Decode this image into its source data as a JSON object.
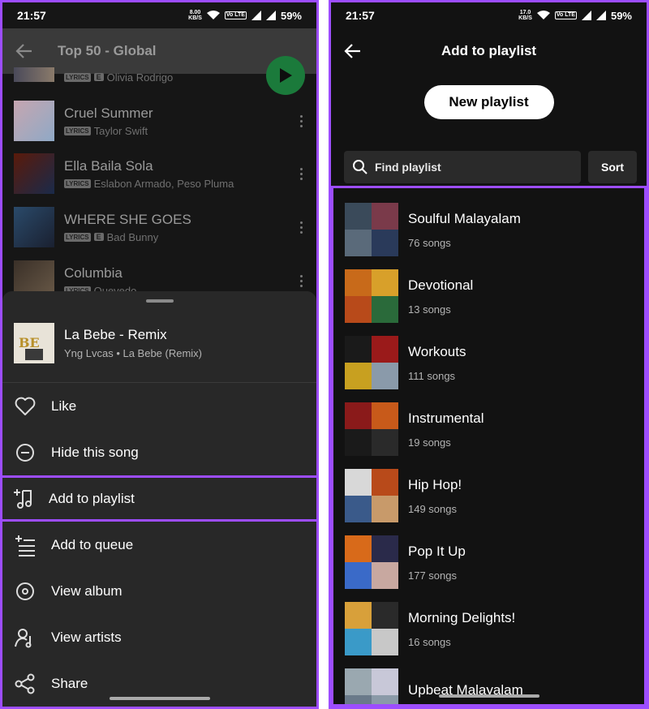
{
  "statusbar": {
    "time": "21:57",
    "left_speed": "8.00",
    "right_speed": "17.0",
    "speed_unit": "KB/S",
    "lte": "Vo LTE",
    "battery": "59%"
  },
  "left": {
    "header_title": "Top 50 - Global",
    "tracks": [
      {
        "name": "",
        "artist": "Olivia Rodrigo",
        "lyrics_badge": "LYRICS",
        "explicit": "E",
        "colors": [
          "#4a4a5a",
          "#8a7a6a"
        ]
      },
      {
        "name": "Cruel Summer",
        "artist": "Taylor Swift",
        "lyrics_badge": "LYRICS",
        "explicit": "",
        "colors": [
          "#c6a6b0",
          "#8fa9c6"
        ]
      },
      {
        "name": "Ella Baila Sola",
        "artist": "Eslabon Armado, Peso Pluma",
        "lyrics_badge": "LYRICS",
        "explicit": "",
        "colors": [
          "#5a1a0a",
          "#1a2a4a"
        ]
      },
      {
        "name": "WHERE SHE GOES",
        "artist": "Bad Bunny",
        "lyrics_badge": "LYRICS",
        "explicit": "E",
        "colors": [
          "#2a4a6a",
          "#1a2030"
        ]
      },
      {
        "name": "Columbia",
        "artist": "Quevedo",
        "lyrics_badge": "LYRICS",
        "explicit": "",
        "colors": [
          "#3a3028",
          "#6a5a48"
        ]
      }
    ],
    "sheet": {
      "song_title": "La Bebe - Remix",
      "song_subtitle": "Yng Lvcas • La Bebe (Remix)",
      "menu": [
        {
          "label": "Like",
          "icon": "heart-icon"
        },
        {
          "label": "Hide this song",
          "icon": "minus-circle-icon"
        },
        {
          "label": "Add to playlist",
          "icon": "add-to-playlist-icon"
        },
        {
          "label": "Add to queue",
          "icon": "add-to-queue-icon"
        },
        {
          "label": "View album",
          "icon": "album-icon"
        },
        {
          "label": "View artists",
          "icon": "artist-icon"
        },
        {
          "label": "Share",
          "icon": "share-icon"
        }
      ]
    },
    "accent_color": "#9d4dff",
    "play_button_color": "#1b7a3b"
  },
  "right": {
    "header_title": "Add to playlist",
    "new_playlist_label": "New playlist",
    "find_placeholder": "Find playlist",
    "sort_label": "Sort",
    "playlists": [
      {
        "name": "Soulful Malayalam",
        "count": "76 songs",
        "colors": [
          "#3a4a5a",
          "#7a3a4a",
          "#5a6a7a",
          "#2a3a5a"
        ]
      },
      {
        "name": "Devotional",
        "count": "13 songs",
        "colors": [
          "#c86a1a",
          "#d8a02a",
          "#b84a1a",
          "#2a6a3a"
        ]
      },
      {
        "name": "Workouts",
        "count": "111 songs",
        "colors": [
          "#1a1a1a",
          "#9a1a1a",
          "#c8a020",
          "#8a9aaa"
        ]
      },
      {
        "name": "Instrumental",
        "count": "19 songs",
        "colors": [
          "#8a1a1a",
          "#c85a1a",
          "#1a1a1a",
          "#2a2a2a"
        ]
      },
      {
        "name": "Hip Hop!",
        "count": "149 songs",
        "colors": [
          "#d8d8d8",
          "#b84a1a",
          "#3a5a8a",
          "#c89a6a"
        ]
      },
      {
        "name": "Pop It Up",
        "count": "177 songs",
        "colors": [
          "#d86a1a",
          "#2a2a4a",
          "#3a6ac8",
          "#c8a8a0"
        ]
      },
      {
        "name": "Morning Delights!",
        "count": "16 songs",
        "colors": [
          "#d8a03a",
          "#2a2a2a",
          "#3a9ac8",
          "#c8c8c8"
        ]
      },
      {
        "name": "Upbeat Malayalam",
        "count": "",
        "colors": [
          "#9aa8b0",
          "#c8c8d8",
          "#6a7a8a",
          "#8a9aa8"
        ]
      }
    ]
  }
}
